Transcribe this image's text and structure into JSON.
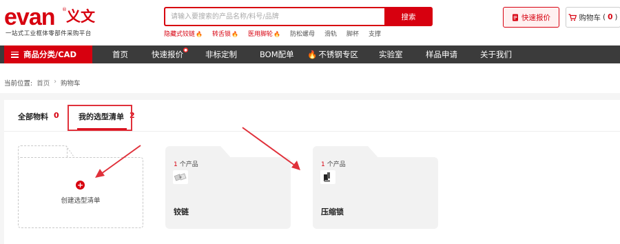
{
  "brand": {
    "logo_text": "evan",
    "logo_cn": "义文",
    "tagline": "一站式工业框体零部件采购平台",
    "color": "#d7000f"
  },
  "search": {
    "placeholder": "请输入要搜索的产品名称/料号/品牌",
    "button": "搜索",
    "hot_words": [
      {
        "label": "隐藏式铰链",
        "hot": true
      },
      {
        "label": "转舌锁",
        "hot": true
      },
      {
        "label": "医用脚轮",
        "hot": true
      },
      {
        "label": "防松螺母",
        "hot": false
      },
      {
        "label": "滑轨",
        "hot": false
      },
      {
        "label": "脚杯",
        "hot": false
      },
      {
        "label": "支撑",
        "hot": false
      }
    ]
  },
  "header_actions": {
    "quick_quote": "快速报价",
    "cart_label": "购物车",
    "cart_count": "0"
  },
  "nav": {
    "category": "商品分类/CAD",
    "items": [
      "首页",
      "快速报价",
      "非标定制",
      "BOM配单",
      "不锈钢专区",
      "实验室",
      "样品申请",
      "关于我们"
    ]
  },
  "breadcrumb": {
    "prefix": "当前位置:",
    "items": [
      "首页",
      "购物车"
    ]
  },
  "tabs": [
    {
      "label": "全部物料",
      "count": "0"
    },
    {
      "label": "我的选型清单",
      "count": "2"
    }
  ],
  "create_card": {
    "label": "创建选型清单"
  },
  "lists": [
    {
      "count": "1",
      "unit": "个产品",
      "name": "铰链"
    },
    {
      "count": "1",
      "unit": "个产品",
      "name": "压缩锁"
    }
  ],
  "colors": {
    "accent": "#d7000f",
    "nav_bg": "#3b3b3b",
    "annotation": "#e0303a"
  }
}
